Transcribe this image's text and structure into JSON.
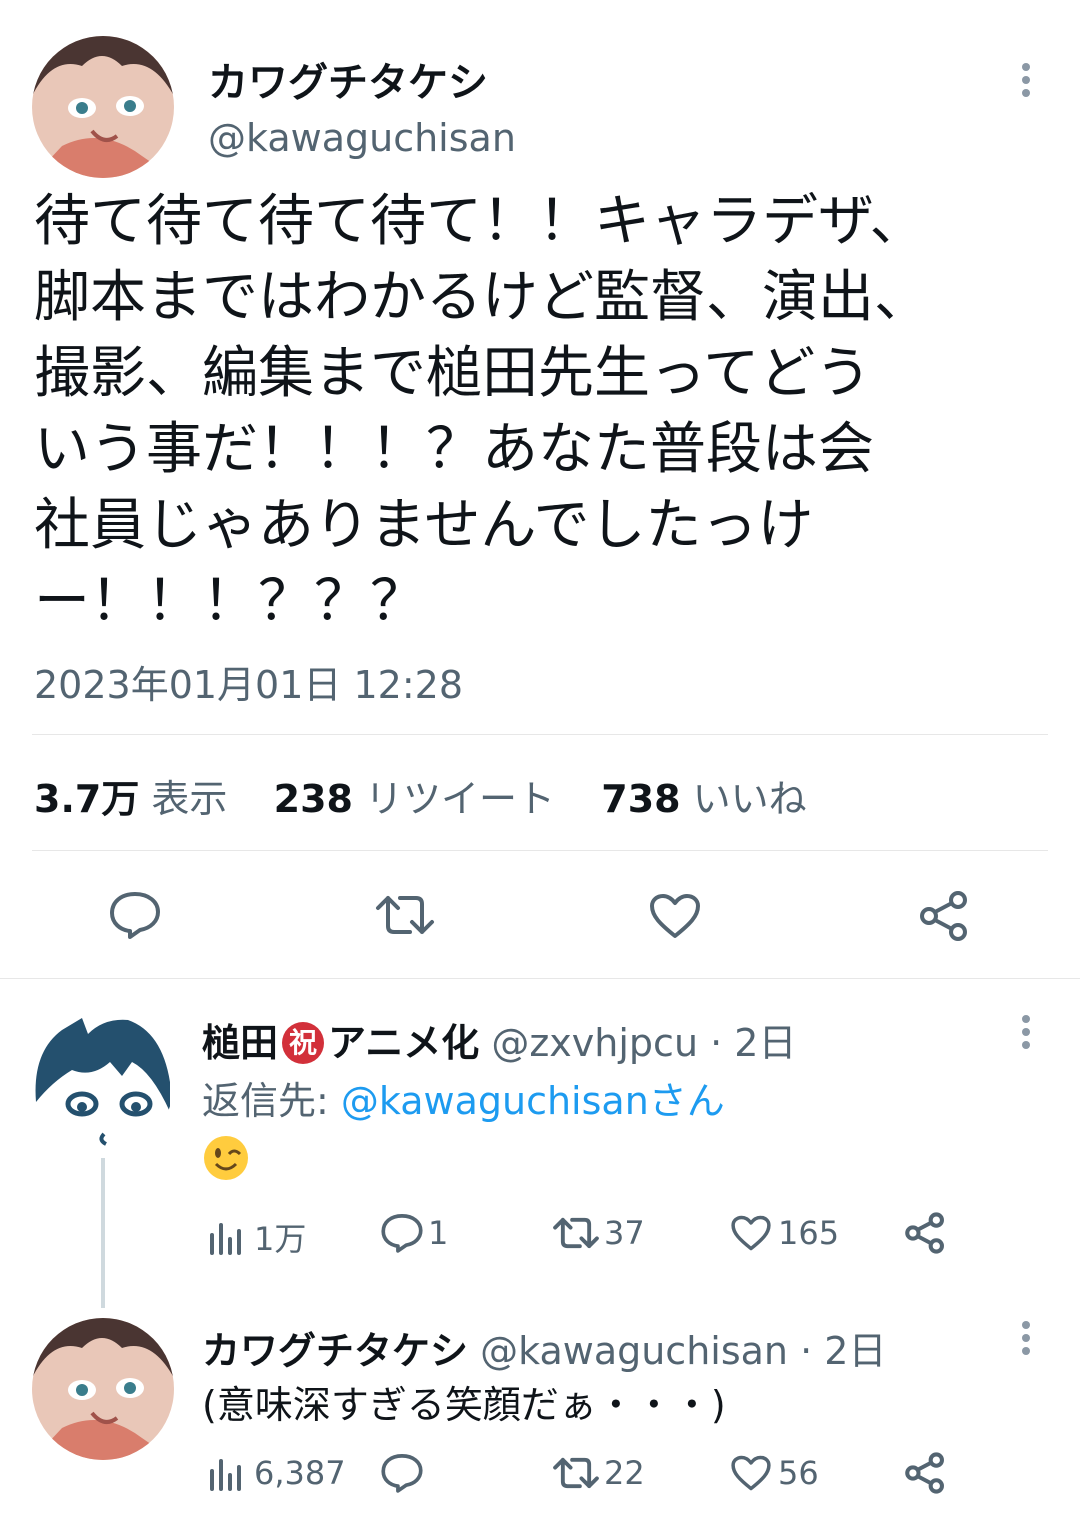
{
  "main_tweet": {
    "display_name": "カワグチタケシ",
    "handle": "@kawaguchisan",
    "text_lines": [
      "待て待て待て待て！！キャラデザ、",
      "脚本まではわかるけど監督、演出、",
      "撮影、編集まで槌田先生ってどう",
      "いう事だ！！！？あなた普段は会",
      "社員じゃありませんでしたっけ",
      "ー！！！？？？"
    ],
    "timestamp": "2023年01月01日 12:28",
    "stats": {
      "views_count": "3.7万",
      "views_label": "表示",
      "retweets_count": "238",
      "retweets_label": "リツイート",
      "likes_count": "738",
      "likes_label": "いいね"
    }
  },
  "reply1": {
    "name_part1": "槌田",
    "badge": "祝",
    "name_part2": "アニメ化",
    "handle": "@zxvhjpcu",
    "time": "· 2日",
    "reply_to_label": "返信先: ",
    "reply_to_handle": "@kawaguchisanさん",
    "emoji": "😉",
    "metrics": {
      "views": "1万",
      "replies": "1",
      "retweets": "37",
      "likes": "165"
    }
  },
  "reply2": {
    "display_name": "カワグチタケシ",
    "handle": "@kawaguchisan",
    "time": "· 2日",
    "text": "(意味深すぎる笑顔だぁ・・・)",
    "metrics": {
      "views": "6,387",
      "replies": "",
      "retweets": "22",
      "likes": "56"
    }
  },
  "colors": {
    "link": "#1d9bf0",
    "muted": "#536471",
    "badge": "#d2303a"
  }
}
